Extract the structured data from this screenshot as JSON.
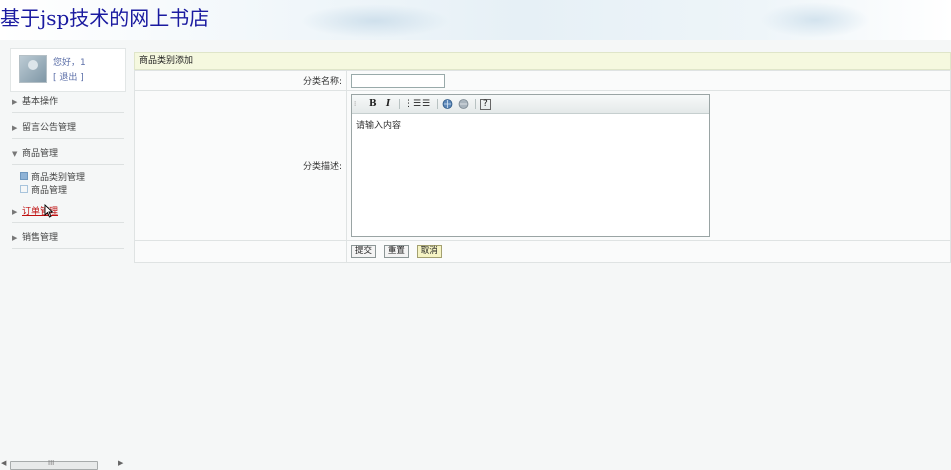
{
  "site": {
    "title": "基于jsp技术的网上书店"
  },
  "user": {
    "greeting": "您好，1",
    "logout": "[ 退出 ]"
  },
  "nav": {
    "items": [
      {
        "label": "基本操作"
      },
      {
        "label": "留言公告管理"
      },
      {
        "label": "商品管理"
      },
      {
        "label": "订单管理"
      },
      {
        "label": "销售管理"
      }
    ],
    "sub_items": [
      {
        "label": "商品类别管理"
      },
      {
        "label": "商品管理"
      }
    ]
  },
  "form": {
    "header": "商品类别添加",
    "name_label": "分类名称:",
    "name_value": "",
    "desc_label": "分类描述:",
    "editor_placeholder": "请输入内容",
    "submit_label": "提交",
    "reset_label": "重置",
    "cancel_label": "取消"
  },
  "scrollbar": {
    "grip": "III"
  },
  "icons": {
    "bold": "B",
    "italic": "I",
    "ordered_list": "⋮☰",
    "unordered_list": "☰",
    "help": "?"
  }
}
